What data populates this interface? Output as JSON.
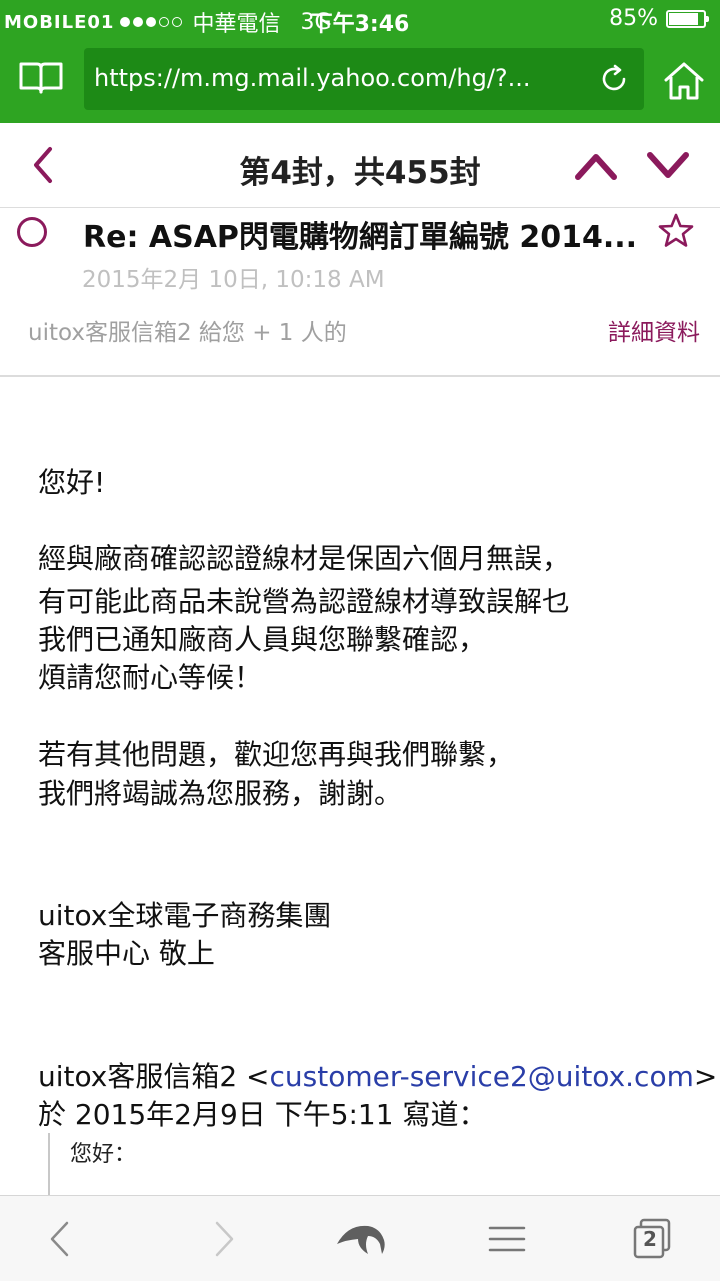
{
  "status_bar": {
    "watermark": "MOBILE01",
    "carrier": "中華電信",
    "network": "3G",
    "time": "下午3:46",
    "battery_text": "85%",
    "battery_level": 0.85
  },
  "browser": {
    "url": "https://m.mg.mail.yahoo.com/hg/?..."
  },
  "mail_nav": {
    "counter": "第4封，共455封"
  },
  "message": {
    "subject": "Re: ASAP閃電購物網訂單編號 2014...",
    "date": "2015年2月 10日, 10:18 AM",
    "recipients": "uitox客服信箱2 給您 + 1 人的",
    "details_label": "詳細資料",
    "body": {
      "greeting": "您好!",
      "p1_l1": "經與廠商確認認證線材是保固六個月無誤，",
      "p1_l2": "有可能此商品未說營為認證線材導致誤解乜",
      "p1_l3": "我們已通知廠商人員與您聯繫確認，",
      "p1_l4": "煩請您耐心等候！",
      "p2_l1": "若有其他問題，歡迎您再與我們聯繫，",
      "p2_l2": "我們將竭誠為您服務，謝謝。",
      "sig_l1": "uitox全球電子商務集團",
      "sig_l2": "客服中心 敬上",
      "quote_sender": "uitox客服信箱2 <",
      "quote_email": "customer-service2@uitox.com",
      "quote_sender_end": ">",
      "quote_date": "於 2015年2月9日 下午5:11 寫道：",
      "quoted_greeting": "您好："
    }
  },
  "toolbar": {
    "tab_count": "2"
  },
  "colors": {
    "chrome_green": "#2ea422",
    "accent": "#8b1a5c",
    "link": "#2a3ea8"
  },
  "icons": [
    "bookmarks-icon",
    "reload-icon",
    "home-icon",
    "back-chevron-icon",
    "previous-message-icon",
    "next-message-icon",
    "star-icon",
    "browser-back-icon",
    "browser-forward-icon",
    "dolphin-icon",
    "menu-icon",
    "tabs-icon"
  ]
}
